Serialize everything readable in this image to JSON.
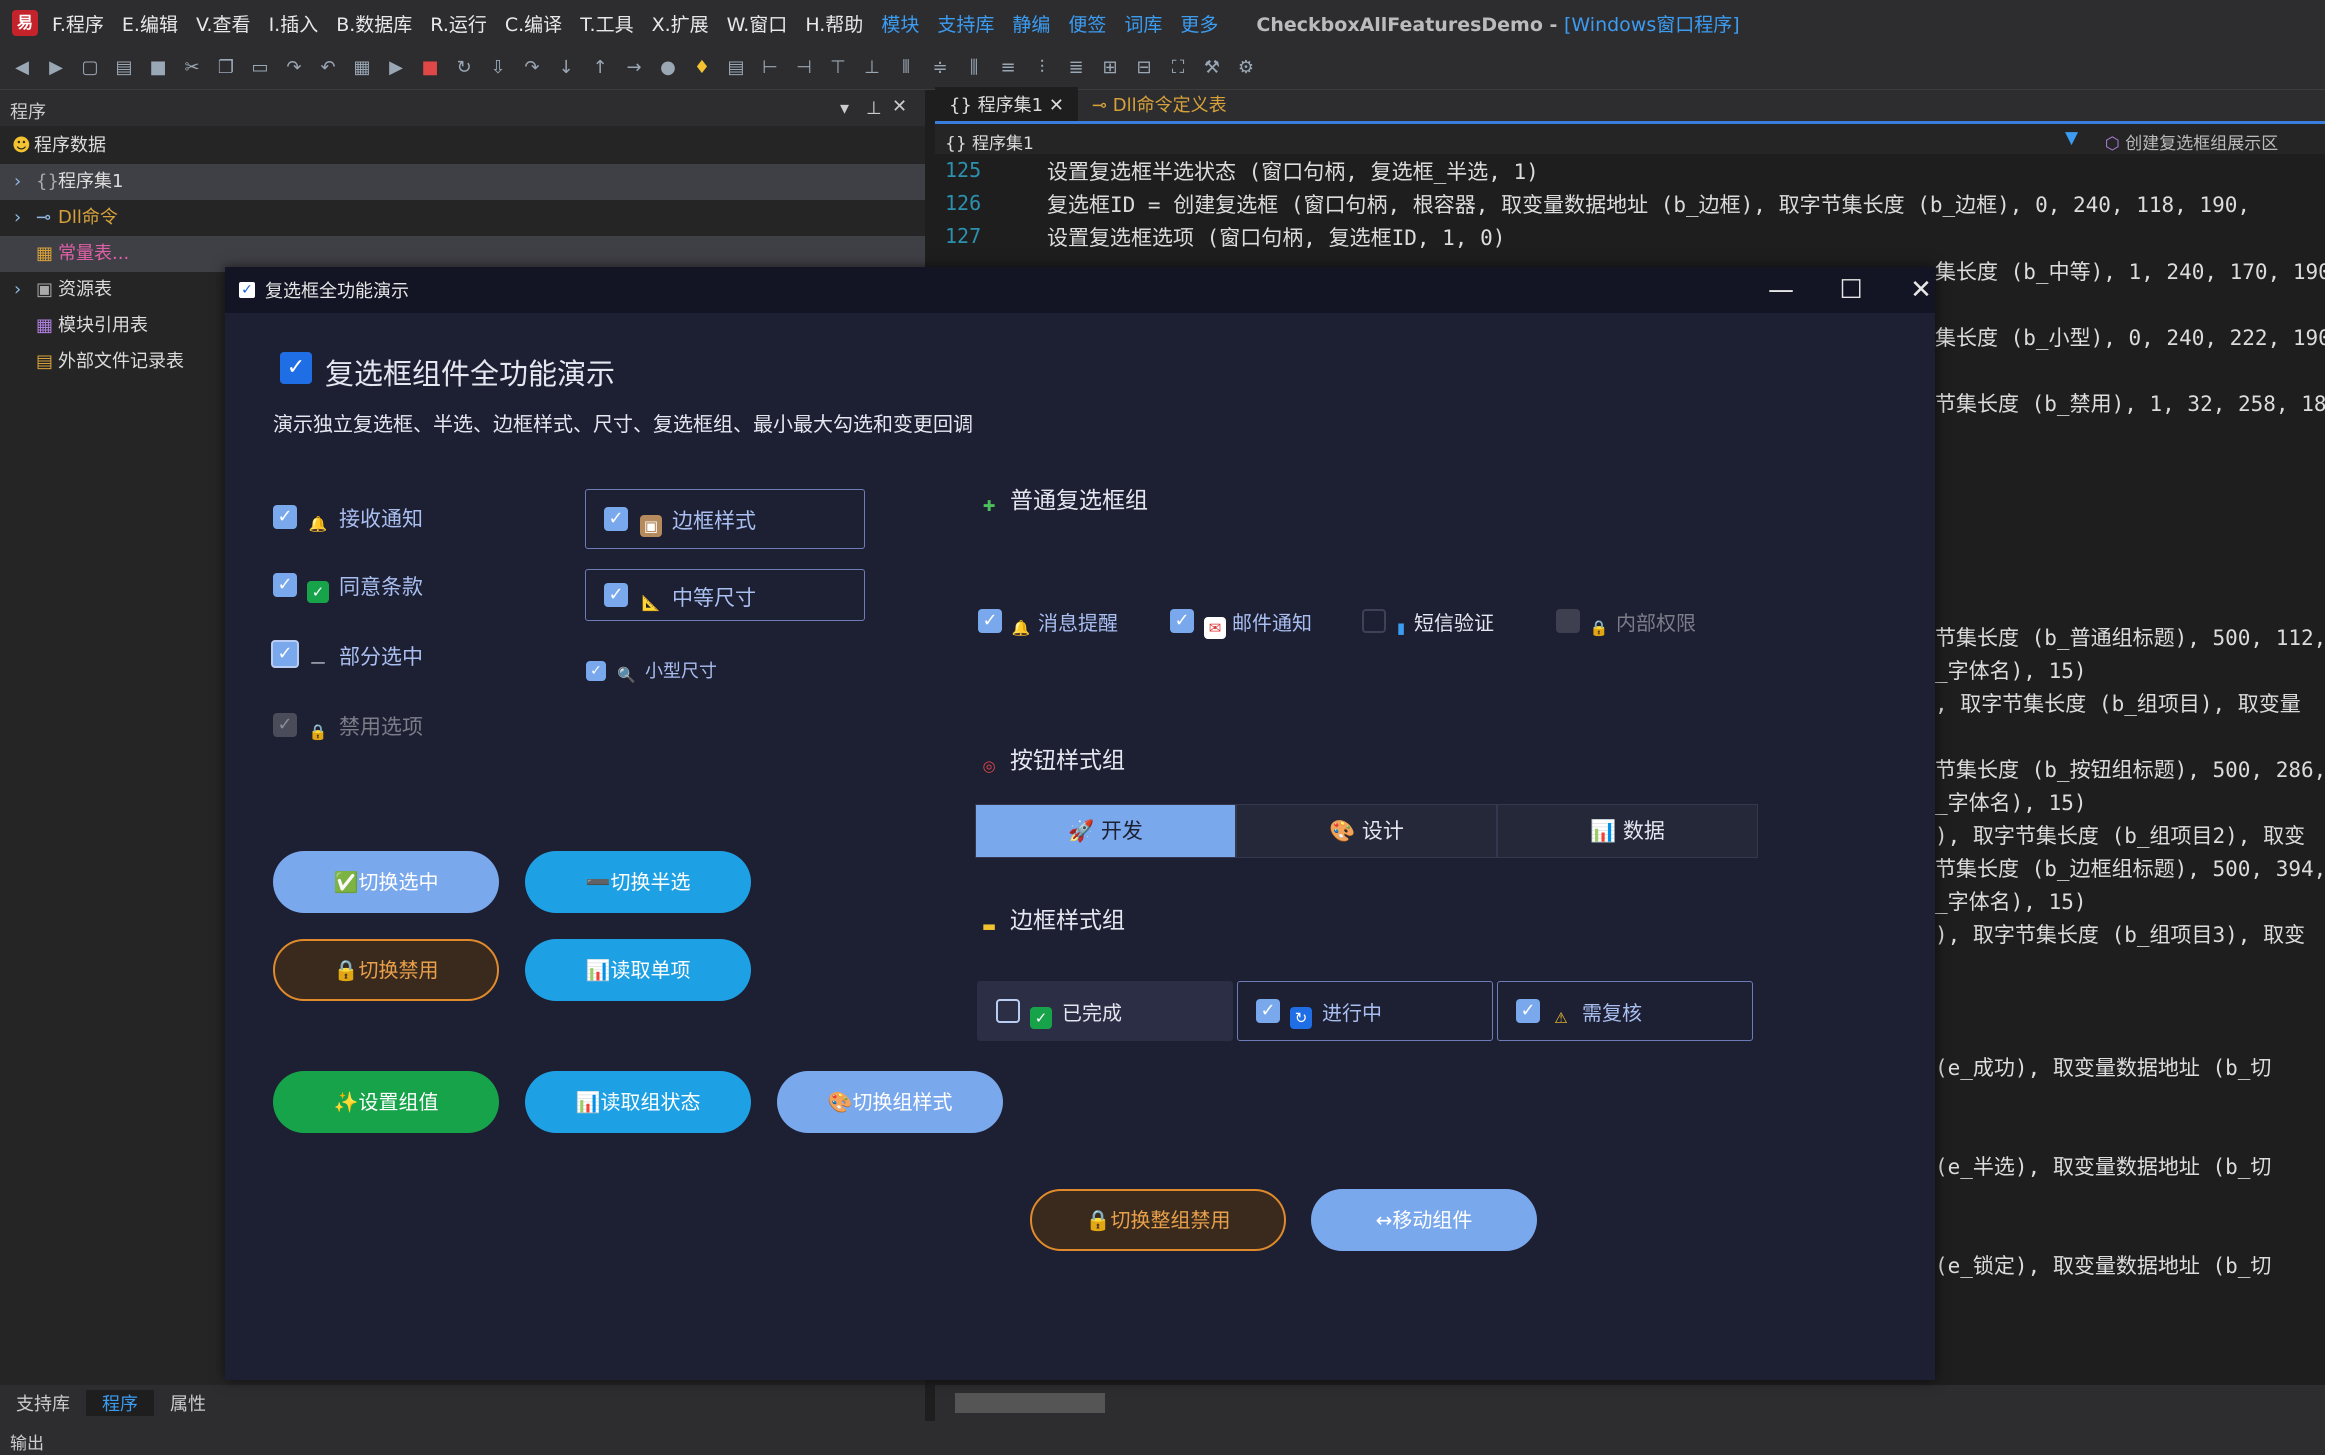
{
  "menubar": {
    "items": [
      "F.程序",
      "E.编辑",
      "V.查看",
      "I.插入",
      "B.数据库",
      "R.运行",
      "C.编译",
      "T.工具",
      "X.扩展",
      "W.窗口",
      "H.帮助"
    ],
    "blue_items": [
      "模块",
      "支持库",
      "静编",
      "便签",
      "词库",
      "更多"
    ],
    "title_main": "CheckboxAllFeaturesDemo - ",
    "title_sub": "[Windows窗口程序]"
  },
  "left_panel": {
    "header": "程序",
    "tree": [
      {
        "label": "程序数据",
        "icon": "smiley-icon"
      },
      {
        "label": "程序集1",
        "icon": "braces-icon"
      },
      {
        "label": "Dll命令",
        "icon": "link-icon"
      },
      {
        "label": "常量表...",
        "icon": "table-icon"
      },
      {
        "label": "资源表",
        "icon": "resource-icon"
      },
      {
        "label": "模块引用表",
        "icon": "module-icon"
      },
      {
        "label": "外部文件记录表",
        "icon": "file-icon"
      }
    ],
    "bottom_tabs": [
      "支持库",
      "程序",
      "属性"
    ],
    "output_label": "输出"
  },
  "editor": {
    "tabs": [
      "程序集1",
      "Dll命令定义表"
    ],
    "breadcrumb": "程序集1",
    "right_crumb": "创建复选框组展示区",
    "line_numbers": [
      "125",
      "126",
      "127"
    ],
    "lines": [
      "设置复选框半选状态 (窗口句柄, 复选框_半选, 1)",
      "复选框ID = 创建复选框 (窗口句柄, 根容器, 取变量数据地址 (b_边框), 取字节集长度 (b_边框), 0, 240, 118, 190,",
      "设置复选框选项 (窗口句柄, 复选框ID, 1, 0)"
    ],
    "right_lines": [
      "集长度 (b_中等), 1, 240, 170, 190,",
      "集长度 (b_小型), 0, 240, 222, 190,",
      "节集长度 (b_禁用), 1, 32, 258, 18",
      "节集长度 (b_普通组标题), 500, 112,",
      "_字体名), 15)",
      ", 取字节集长度 (b_组项目), 取变量",
      "节集长度 (b_按钮组标题), 500, 286,",
      "_字体名), 15)",
      "), 取字节集长度 (b_组项目2), 取变",
      "节集长度 (b_边框组标题), 500, 394,",
      "_字体名), 15)",
      "), 取字节集长度 (b_组项目3), 取变",
      "(e_成功), 取变量数据地址 (b_切",
      "(e_半选), 取变量数据地址 (b_切",
      "(e_锁定), 取变量数据地址 (b_切"
    ]
  },
  "demo": {
    "window_title": "复选框全功能演示",
    "heading": "复选框组件全功能演示",
    "subtitle": "演示独立复选框、半选、边框样式、尺寸、复选框组、最小最大勾选和变更回调",
    "left_checks": [
      {
        "label": "接收通知",
        "state": "checked",
        "icon": "bell-icon"
      },
      {
        "label": "同意条款",
        "state": "checked",
        "icon": "check-mark-icon"
      },
      {
        "label": "部分选中",
        "state": "indeterminate",
        "icon": "dash-icon"
      },
      {
        "label": "禁用选项",
        "state": "disabled",
        "icon": "lock-icon"
      }
    ],
    "right_checks": [
      {
        "label": "边框样式",
        "icon": "package-icon"
      },
      {
        "label": "中等尺寸",
        "icon": "ruler-icon"
      },
      {
        "label": "小型尺寸",
        "icon": "magnifier-icon"
      }
    ],
    "buttons": {
      "toggle_checked": "✅切换选中",
      "toggle_half": "➖切换半选",
      "toggle_disabled": "🔒切换禁用",
      "read_single": "📊读取单项",
      "set_group": "✨设置组值",
      "read_group": "📊读取组状态",
      "toggle_style": "🎨切换组样式",
      "toggle_all_disabled": "🔒切换整组禁用",
      "move_component": "↔移动组件"
    },
    "group1": {
      "title": "普通复选框组",
      "items": [
        {
          "label": "消息提醒",
          "checked": true
        },
        {
          "label": "邮件通知",
          "checked": true
        },
        {
          "label": "短信验证",
          "checked": false
        },
        {
          "label": "内部权限",
          "checked": false,
          "disabled": true
        }
      ]
    },
    "group2": {
      "title": "按钮样式组",
      "items": [
        "🚀 开发",
        "🎨 设计",
        "📊 数据"
      ],
      "active_index": 0
    },
    "group3": {
      "title": "边框样式组",
      "items": [
        {
          "label": "已完成",
          "checked": false
        },
        {
          "label": "进行中",
          "checked": true
        },
        {
          "label": "需复核",
          "checked": true
        }
      ]
    }
  },
  "colors": {
    "accent": "#7aa8ec",
    "blue_pill": "#1ea0e4",
    "light_pill": "#7aa8ec",
    "green_pill": "#17a34a",
    "orange_pill_border": "#e08a2c"
  }
}
